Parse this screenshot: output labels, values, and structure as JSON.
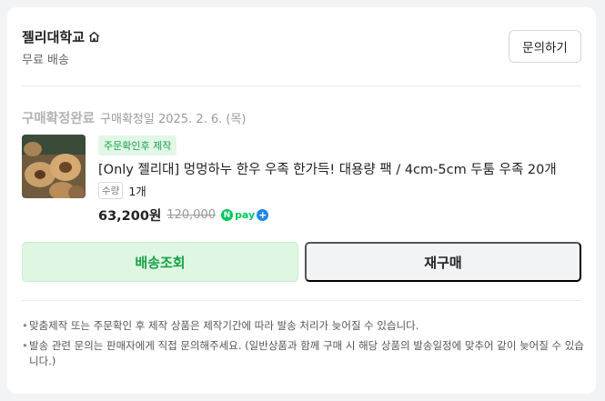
{
  "store": {
    "name": "젤리대학교",
    "shipping": "무료 배송",
    "inquiry_button": "문의하기"
  },
  "order": {
    "status": "구매확정완료",
    "confirm_date": "구매확정일 2025. 2. 6. (목)"
  },
  "product": {
    "badge": "주문확인후 제작",
    "title": "[Only 젤리대] 멍멍하누 한우 우족 한가득! 대용량 팩 / 4cm-5cm 두툼 우족 20개",
    "qty_label": "수량",
    "qty_value": "1개",
    "price": "63,200원",
    "original_price": "120,000",
    "npay_text": "pay",
    "npay_n": "N",
    "npay_plus": "+"
  },
  "actions": {
    "track_button": "배송조회",
    "rebuy_button": "재구매"
  },
  "notes": [
    "맞춤제작 또는 주문확인 후 제작 상품은 제작기간에 따라 발송 처리가 늦어질 수 있습니다.",
    "발송 관련 문의는 판매자에게 직접 문의해주세요. (일반상품과 함께 구매 시 해당 상품의 발송일정에 맞추어 같이 늦어질 수 있습니다.)"
  ],
  "colors": {
    "accent_green": "#18a34a",
    "badge_bg": "#e3f7e7",
    "track_bg": "#def6e2",
    "npay_green": "#03c75a"
  },
  "icons": {
    "home": "home-icon",
    "thumbnail": "product-thumbnail"
  }
}
